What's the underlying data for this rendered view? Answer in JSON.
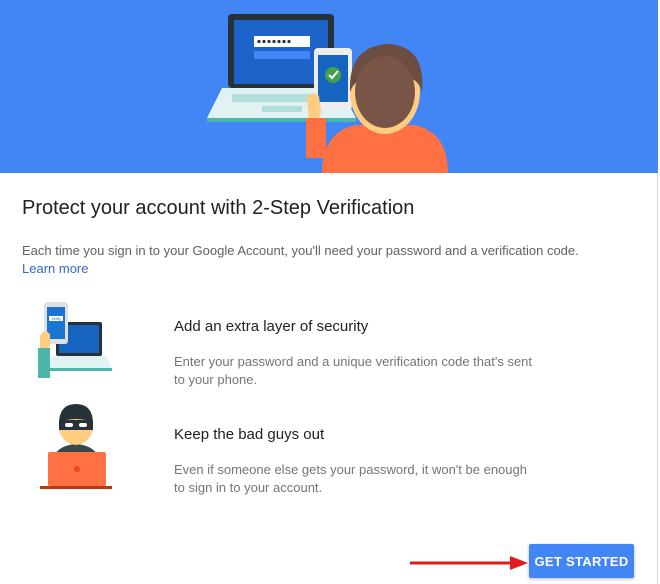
{
  "title": "Protect your account with 2-Step Verification",
  "description": "Each time you sign in to your Google Account, you'll need your password and a verification code.",
  "learn_more": "Learn more",
  "features": [
    {
      "title": "Add an extra layer of security",
      "description": "Enter your password and a unique verification code that's sent to your phone.",
      "icon": "laptop-phone-icon"
    },
    {
      "title": "Keep the bad guys out",
      "description": "Even if someone else gets your password, it won't be enough to sign in to your account.",
      "icon": "burglar-icon"
    }
  ],
  "phone_screen_text": "Verify",
  "button_label": "GET STARTED",
  "colors": {
    "hero_bg": "#4285f4",
    "button_bg": "#4285f4",
    "link": "#3367d6",
    "arrow": "#e21b1b"
  }
}
